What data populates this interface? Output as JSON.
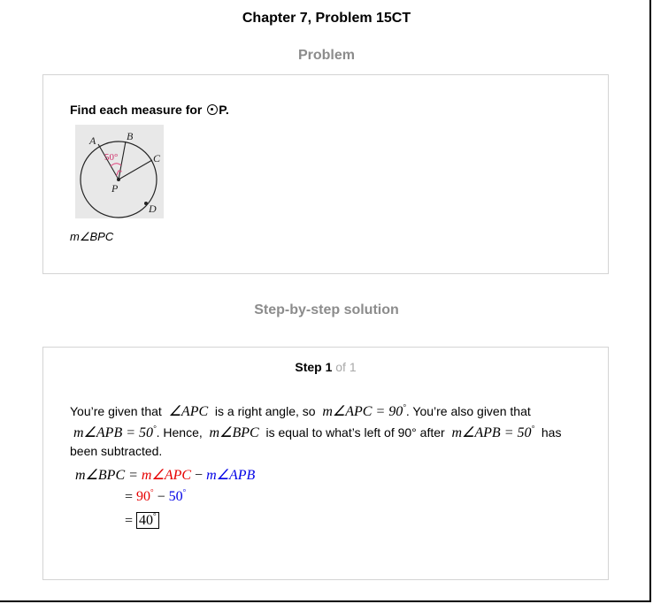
{
  "title": "Chapter 7, Problem 15CT",
  "problem": {
    "heading": "Problem",
    "instruction_prefix": "Find each measure for ",
    "instruction_suffix": "P.",
    "figure": {
      "labels": {
        "A": "A",
        "B": "B",
        "C": "C",
        "D": "D",
        "P": "P"
      },
      "angle_label": "50°"
    },
    "asked": "m∠BPC"
  },
  "solution": {
    "heading": "Step-by-step solution",
    "step_word": "Step 1",
    "step_of": "of 1",
    "line1": {
      "t1": "You’re given that",
      "m1": "∠APC",
      "t2": "is a right angle, so",
      "m2": "m∠APC = 90",
      "t3": ". You’re also given that"
    },
    "line2": {
      "m1": "m∠APB = 50",
      "t1": ". Hence,",
      "m2": "m∠BPC",
      "t2": "is equal to what’s left of 90° after",
      "m3": "m∠APB = 50",
      "t3": "has"
    },
    "line3": "been subtracted.",
    "eq1": {
      "lhs": "m∠BPC = ",
      "a": "m∠APC",
      "minus": " − ",
      "b": "m∠APB"
    },
    "eq2": {
      "eq": "= ",
      "a": "90",
      "minus": " − ",
      "b": "50"
    },
    "eq3": {
      "eq": "= ",
      "result": "40"
    },
    "degree": "°"
  },
  "colors": {
    "red": "#e60000",
    "blue": "#0000e6",
    "heading_gray": "#8c8c8c"
  }
}
